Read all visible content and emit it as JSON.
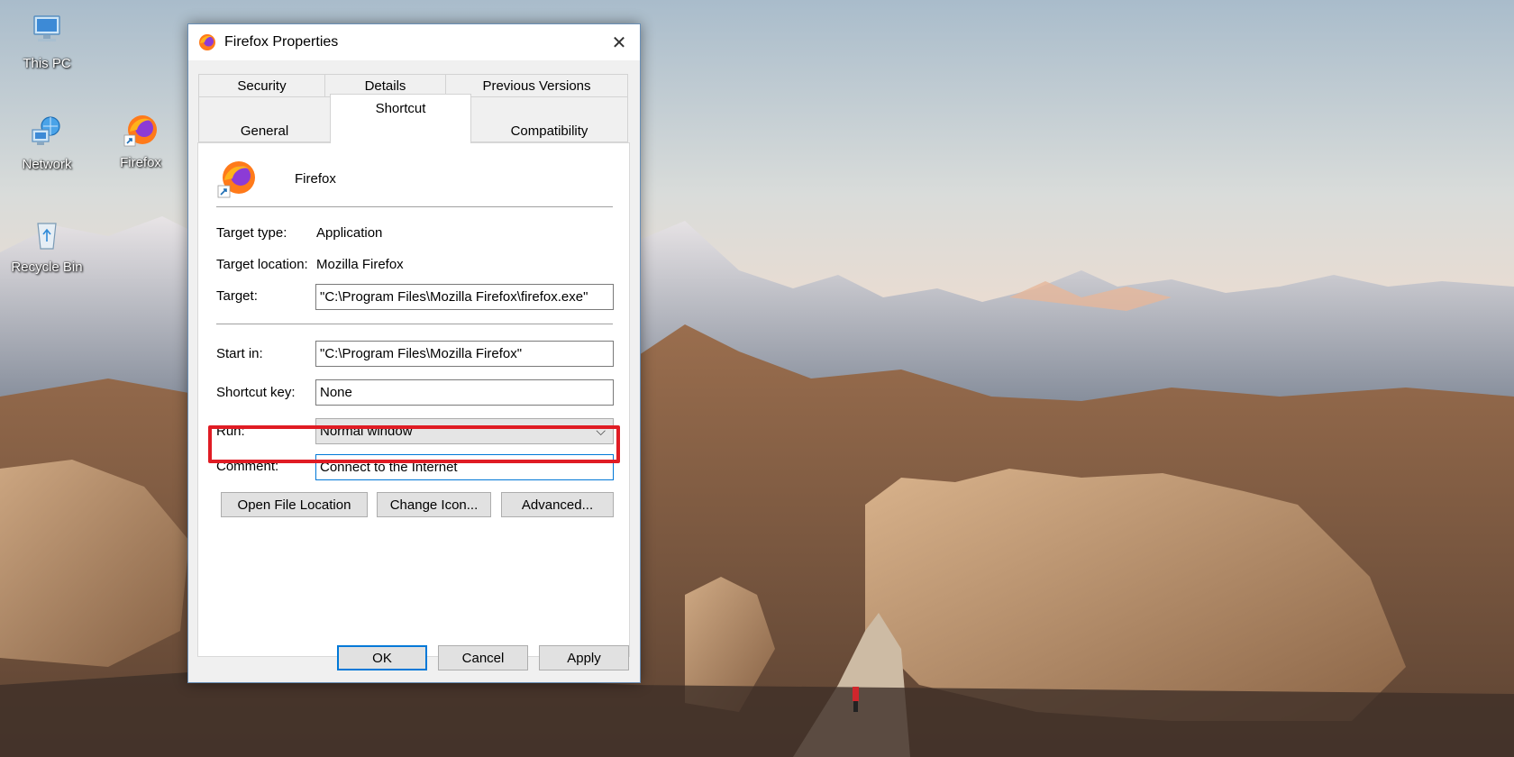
{
  "desktop": {
    "icons": [
      {
        "label": "This PC",
        "icon": "computer-icon"
      },
      {
        "label": "Network",
        "icon": "network-icon"
      },
      {
        "label": "Firefox",
        "icon": "firefox-shortcut-icon"
      },
      {
        "label": "Recycle Bin",
        "icon": "recycle-bin-icon"
      }
    ]
  },
  "dialog": {
    "title": "Firefox Properties",
    "close_glyph": "✕",
    "tabs_row1": [
      "Security",
      "Details",
      "Previous Versions"
    ],
    "tabs_row2": [
      "General",
      "Shortcut",
      "Compatibility"
    ],
    "active_tab": "Shortcut",
    "app_name": "Firefox",
    "fields": {
      "target_type_label": "Target type:",
      "target_type_value": "Application",
      "target_location_label": "Target location:",
      "target_location_value": "Mozilla Firefox",
      "target_label": "Target:",
      "target_value": "\"C:\\Program Files\\Mozilla Firefox\\firefox.exe\"",
      "start_in_label": "Start in:",
      "start_in_value": "\"C:\\Program Files\\Mozilla Firefox\"",
      "shortcut_key_label": "Shortcut key:",
      "shortcut_key_value": "None",
      "run_label": "Run:",
      "run_value": "Normal window",
      "comment_label": "Comment:",
      "comment_value": "Connect to the Internet"
    },
    "buttons": {
      "open_file_location": "Open File Location",
      "change_icon": "Change Icon...",
      "advanced": "Advanced...",
      "ok": "OK",
      "cancel": "Cancel",
      "apply": "Apply"
    },
    "highlight_color": "#e01c24",
    "focus_color": "#0078d7"
  }
}
